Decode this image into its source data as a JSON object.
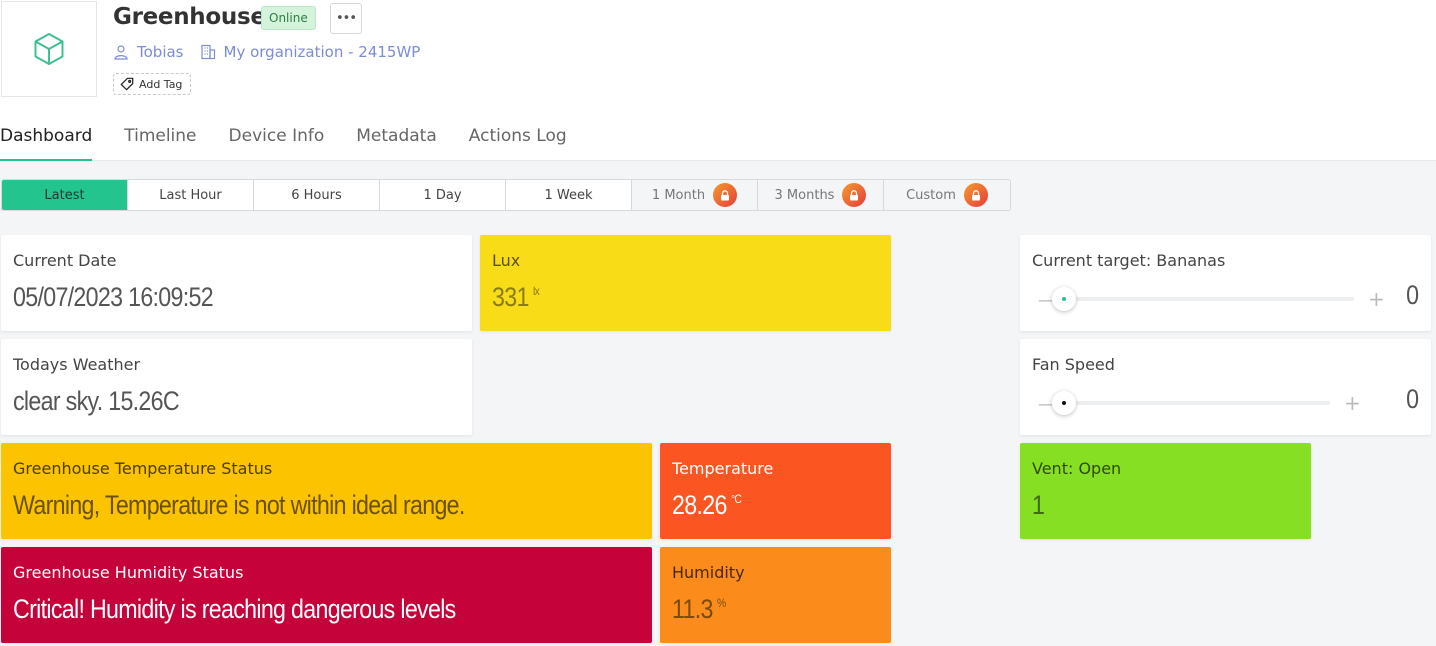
{
  "header": {
    "title": "Greenhouse",
    "status": "Online",
    "owner": "Tobias",
    "organization": "My organization - 2415WP",
    "add_tag_label": "Add Tag",
    "more_label": "•••"
  },
  "tabs": [
    {
      "label": "Dashboard",
      "active": true
    },
    {
      "label": "Timeline"
    },
    {
      "label": "Device Info"
    },
    {
      "label": "Metadata"
    },
    {
      "label": "Actions Log"
    }
  ],
  "time_ranges": [
    {
      "label": "Latest",
      "active": true
    },
    {
      "label": "Last Hour"
    },
    {
      "label": "6 Hours"
    },
    {
      "label": "1 Day"
    },
    {
      "label": "1 Week"
    },
    {
      "label": "1 Month",
      "locked": true
    },
    {
      "label": "3 Months",
      "locked": true
    },
    {
      "label": "Custom",
      "locked": true
    }
  ],
  "widgets": {
    "current_date": {
      "label": "Current Date",
      "value": "05/07/2023 16:09:52"
    },
    "lux": {
      "label": "Lux",
      "value": "331",
      "unit": "lx",
      "color": "#f8dc18"
    },
    "weather": {
      "label": "Todays Weather",
      "value": "clear sky. 15.26C"
    },
    "temp_status": {
      "label": "Greenhouse Temperature Status",
      "value": "Warning, Temperature is not within ideal range.",
      "color": "#fcc300"
    },
    "temperature": {
      "label": "Temperature",
      "value": "28.26",
      "unit": "°C",
      "color": "#fb5622"
    },
    "humidity_status": {
      "label": "Greenhouse Humidity Status",
      "value": "Critical! Humidity is reaching dangerous levels",
      "color": "#c6023a"
    },
    "humidity": {
      "label": "Humidity",
      "value": "11.3",
      "unit": "%",
      "color": "#fb8c1b"
    },
    "target": {
      "label": "Current target: Bananas",
      "value": "0",
      "level": 0,
      "minus": "—",
      "plus": "+",
      "thumb_color": "#23c38e"
    },
    "fan_speed": {
      "label": "Fan Speed",
      "value": "0",
      "level": 0,
      "minus": "—",
      "plus": "+",
      "thumb_color": "#111111"
    },
    "vent": {
      "label": "Vent: Open",
      "value": "1",
      "color": "#86df23"
    }
  },
  "colors": {
    "accent": "#23c38e",
    "link": "#7b8cd9"
  }
}
